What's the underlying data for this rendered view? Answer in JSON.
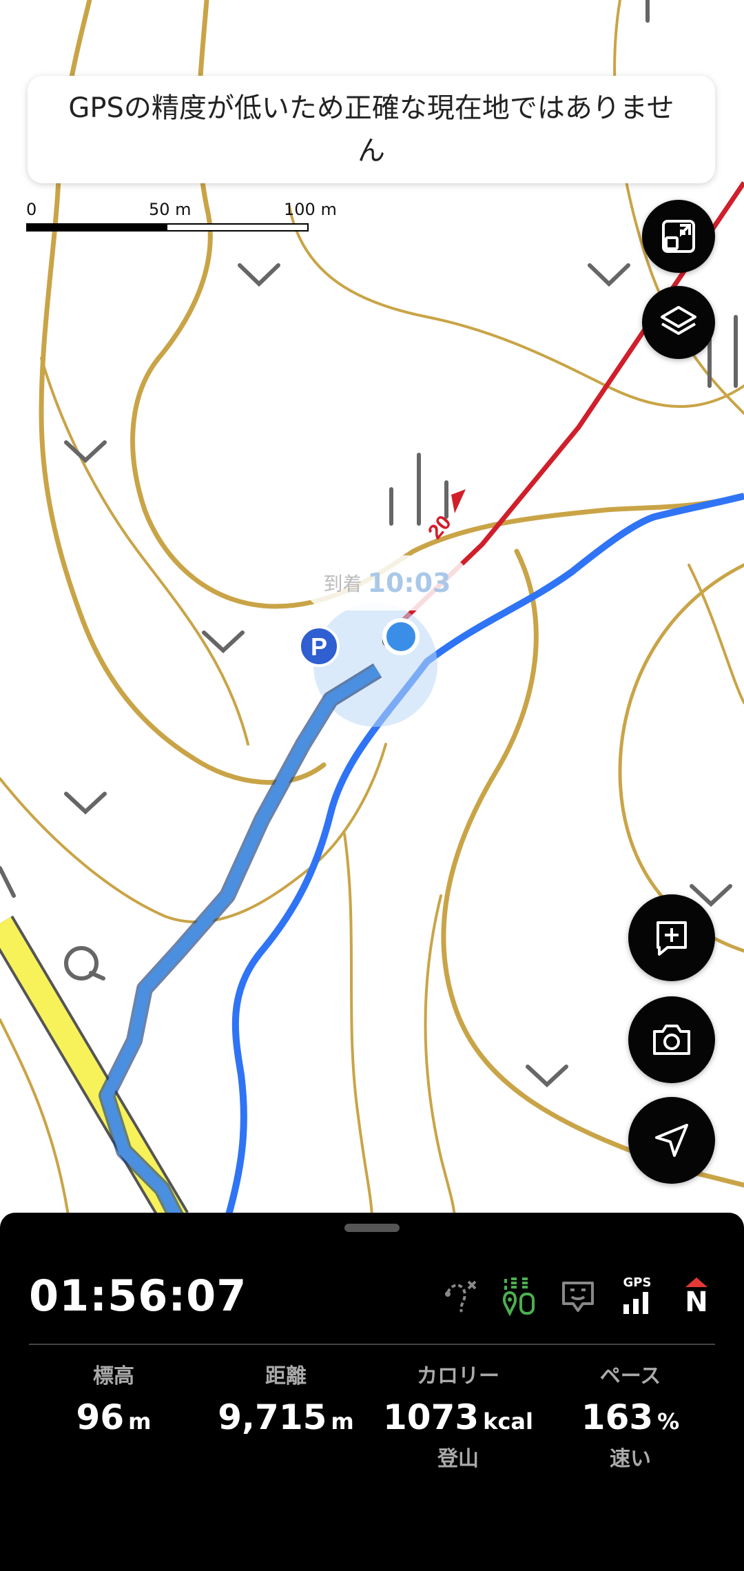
{
  "banner": {
    "text": "GPSの精度が低いため正確な現在地ではありません"
  },
  "scale_bar": {
    "labels": [
      "0",
      "50 m",
      "100 m"
    ]
  },
  "map": {
    "eta_label": "到着",
    "eta_time": "10:03",
    "parking_marker": "P",
    "route_marker_label": "20",
    "colors": {
      "contour": "#c9a447",
      "stream": "#2f74f5",
      "track": "#4a8fe0",
      "road": "#f7f25a",
      "route": "#d01f2b",
      "location": "#3b8ee8"
    }
  },
  "fabs": [
    "fullscreen-exit-icon",
    "layers-icon",
    "add-memo-icon",
    "camera-icon",
    "navigation-icon"
  ],
  "panel": {
    "timer": "01:56:07",
    "status_icons": [
      "route-off-icon",
      "companion-icon",
      "chat-icon",
      "gps-signal-icon",
      "north-compass-icon"
    ],
    "gps_label": "GPS",
    "compass_label": "N",
    "stats": [
      {
        "label": "標高",
        "value": "96",
        "unit": "m",
        "sub": ""
      },
      {
        "label": "距離",
        "value": "9,715",
        "unit": "m",
        "sub": ""
      },
      {
        "label": "カロリー",
        "value": "1073",
        "unit": "kcal",
        "sub": "登山"
      },
      {
        "label": "ペース",
        "value": "163",
        "unit": "%",
        "sub": "速い"
      }
    ]
  }
}
